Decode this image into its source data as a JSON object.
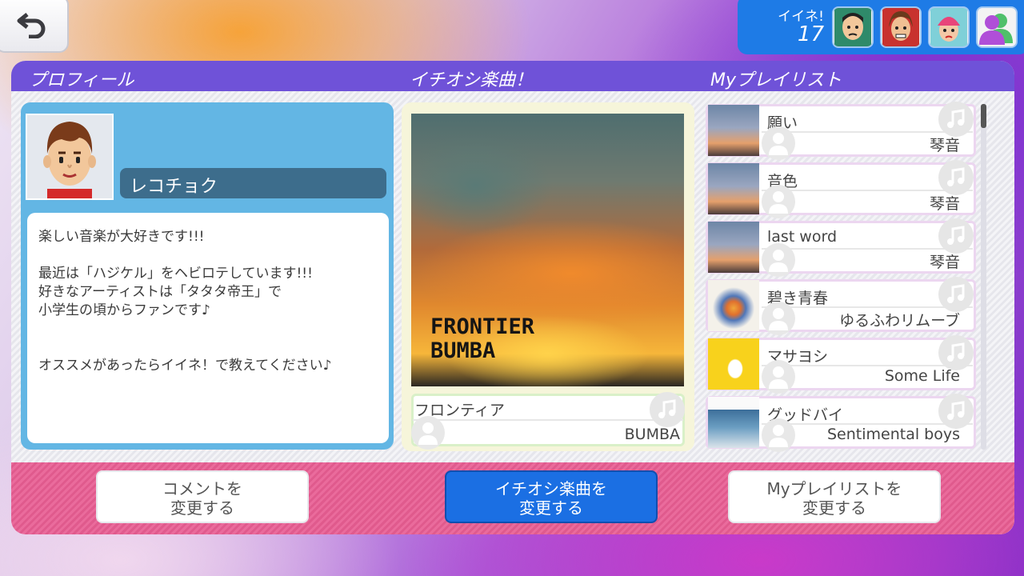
{
  "iine": {
    "label": "イイネ!",
    "count": "17"
  },
  "sections": {
    "profile": "プロフィール",
    "favorite": "イチオシ楽曲！",
    "playlist": "Myプレイリスト"
  },
  "profile": {
    "username": "レコチョク",
    "comment": "楽しい音楽が大好きです!!!\n\n最近は「ハジケル」をヘビロテしています!!!\n好きなアーティストは「タタタ帝王」で\n小学生の頃からファンです♪\n\n\nオススメがあったらイイネ！で教えてください♪"
  },
  "favorite": {
    "art_text": "FRONTIER\nBUMBA",
    "title": "フロンティア",
    "artist": "BUMBA"
  },
  "playlist": [
    {
      "title": "願い",
      "artist": "琴音"
    },
    {
      "title": "音色",
      "artist": "琴音"
    },
    {
      "title": "last word",
      "artist": "琴音"
    },
    {
      "title": "碧き青春",
      "artist": "ゆるふわリムーブ"
    },
    {
      "title": "マサヨシ",
      "artist": "Some Life"
    },
    {
      "title": "グッドバイ",
      "artist": "Sentimental boys"
    }
  ],
  "buttons": {
    "change_comment": "コメントを\n変更する",
    "change_favorite": "イチオシ楽曲を\n変更する",
    "change_playlist": "Myプレイリストを\n変更する"
  },
  "colors": {
    "header": "#6f52d8",
    "iine_panel": "#1e7be6",
    "profile_bg": "#63b6e4",
    "selected_button": "#1b6fe3",
    "bottom_bar": "#e05a8d"
  },
  "icons": [
    "back-arrow-icon",
    "music-note-icon",
    "person-icon"
  ]
}
